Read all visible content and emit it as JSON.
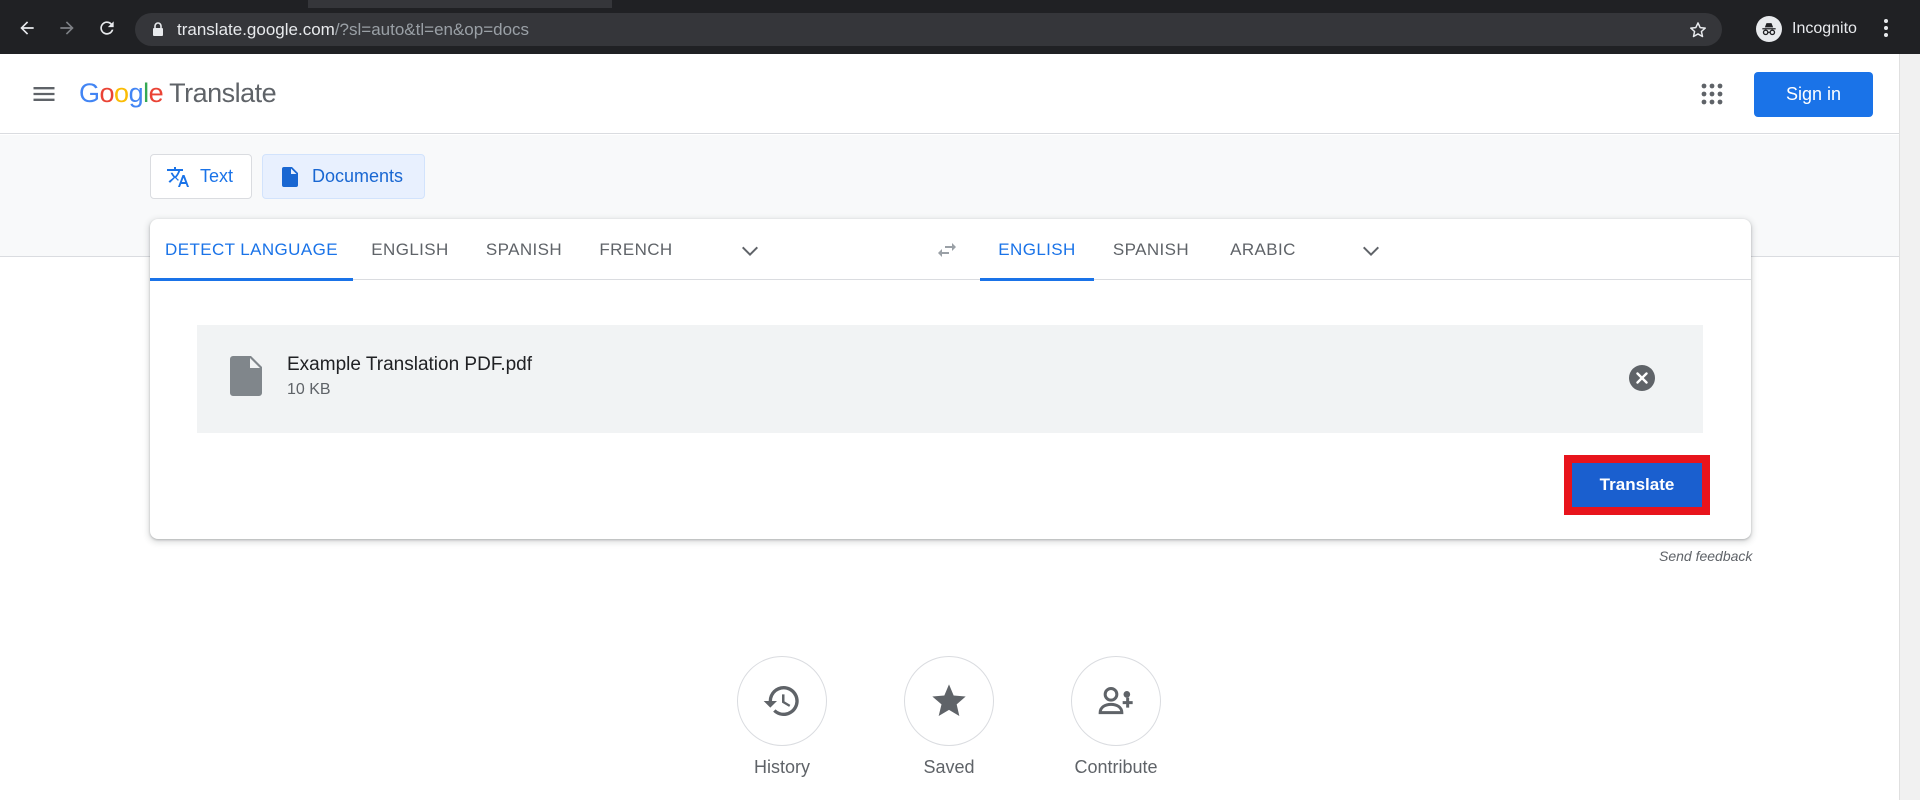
{
  "browser": {
    "url_host": "translate.google.com",
    "url_rest": "/?sl=auto&tl=en&op=docs",
    "profile_label": "Incognito",
    "icons": [
      "back-icon",
      "forward-icon",
      "reload-icon",
      "lock-icon",
      "star-icon",
      "incognito-icon",
      "kebab-menu-icon"
    ]
  },
  "header": {
    "logo_letters": [
      "G",
      "o",
      "o",
      "g",
      "l",
      "e"
    ],
    "product": "Translate",
    "signin_label": "Sign in",
    "icons": [
      "hamburger-menu-icon",
      "apps-grid-icon"
    ]
  },
  "modes": {
    "text_label": "Text",
    "documents_label": "Documents"
  },
  "source_langs": [
    "DETECT LANGUAGE",
    "ENGLISH",
    "SPANISH",
    "FRENCH"
  ],
  "target_langs": [
    "ENGLISH",
    "SPANISH",
    "ARABIC"
  ],
  "file": {
    "name": "Example Translation PDF.pdf",
    "size": "10 KB"
  },
  "translate_label": "Translate",
  "feedback_label": "Send feedback",
  "actions": {
    "history": "History",
    "saved": "Saved",
    "contribute": "Contribute"
  },
  "colors": {
    "accent": "#1a73e8",
    "highlight_border": "#e8141c",
    "chrome_bg": "#202124"
  }
}
